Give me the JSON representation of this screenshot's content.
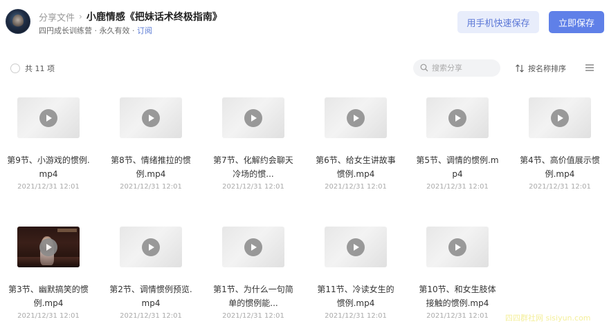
{
  "header": {
    "root_label": "分享文件",
    "separator": "›",
    "title": "小鹿情感《把妹话术终极指南》",
    "owner_text": "四円成长训练营 · 永久有效 · ",
    "subscribe_label": "订阅",
    "phone_save_label": "用手机快速保存",
    "save_label": "立即保存"
  },
  "toolbar": {
    "count_label": "共 11 项",
    "search_placeholder": "搜索分享",
    "sort_label": "按名称排序"
  },
  "files": [
    {
      "name": "第9节、小游戏的惯例.mp4",
      "date": "2021/12/31 12:01",
      "thumb": "gray"
    },
    {
      "name": "第8节、情绪推拉的惯例.mp4",
      "date": "2021/12/31 12:01",
      "thumb": "gray"
    },
    {
      "name": "第7节、化解约会聊天冷场的惯...",
      "date": "2021/12/31 12:01",
      "thumb": "gray"
    },
    {
      "name": "第6节、给女生讲故事惯例.mp4",
      "date": "2021/12/31 12:01",
      "thumb": "gray"
    },
    {
      "name": "第5节、调情的惯例.mp4",
      "date": "2021/12/31 12:01",
      "thumb": "gray"
    },
    {
      "name": "第4节、高价值展示惯例.mp4",
      "date": "2021/12/31 12:01",
      "thumb": "gray"
    },
    {
      "name": "第3节、幽默搞笑的惯例.mp4",
      "date": "2021/12/31 12:01",
      "thumb": "photo"
    },
    {
      "name": "第2节、调情惯例预览.mp4",
      "date": "2021/12/31 12:01",
      "thumb": "gray"
    },
    {
      "name": "第1节、为什么一句简单的惯例能...",
      "date": "2021/12/31 12:01",
      "thumb": "gray"
    },
    {
      "name": "第11节、冷读女生的惯例.mp4",
      "date": "2021/12/31 12:01",
      "thumb": "gray"
    },
    {
      "name": "第10节、和女生肢体接触的惯例.mp4",
      "date": "2021/12/31 12:01",
      "thumb": "gray"
    }
  ],
  "watermark": "四四群社网 sisiyun.com",
  "colors": {
    "primary": "#5f80e8",
    "primary_light": "#e8edfb",
    "link": "#5b7bd5"
  }
}
